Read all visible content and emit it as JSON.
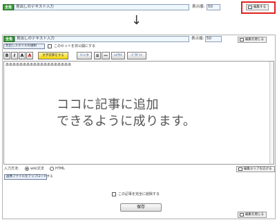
{
  "collapsed": {
    "tag": "全角",
    "title_value": "見出しのテキスト入力",
    "order_label": "表示順:",
    "order_value": "50",
    "toggle_button_label": "編集する"
  },
  "arrow": "↓",
  "expanded": {
    "tag": "全角",
    "title_value": "見出しのテキスト入力",
    "order_label": "表示順:",
    "order_value": "50",
    "close_button_label": "編集を閉じる",
    "style_select": "見出しスタイルの選択",
    "hide_checkbox_label": "このセットを非公開にする",
    "format_buttons": [
      "B",
      "I",
      "A",
      "A",
      "文字装飾をする",
      "リンク",
      "≡",
      "—",
      "ﾚｲｱｳﾄ",
      "ﾌﾞﾗｸﾞｲﾝ"
    ],
    "editor_text": "あああああああああああああああああああ",
    "overlay_line1": "ココに記事に追加",
    "overlay_line2": "できるように成ります。",
    "input_method_label": "入力方法:",
    "option_wiki": "wiki文法",
    "option_html": "HTML",
    "add_area_button": "編集エリアを広げる",
    "attach_select": "画像ファイルをアップロードする",
    "delete_checkbox_label": "この記事を完全に削除する",
    "save_button": "保存",
    "close_bottom_button": "編集を閉じる"
  },
  "colors": {
    "tag_green": "#3a9a3a",
    "highlight_red": "#e02020",
    "input_bg": "#eef6ff"
  }
}
